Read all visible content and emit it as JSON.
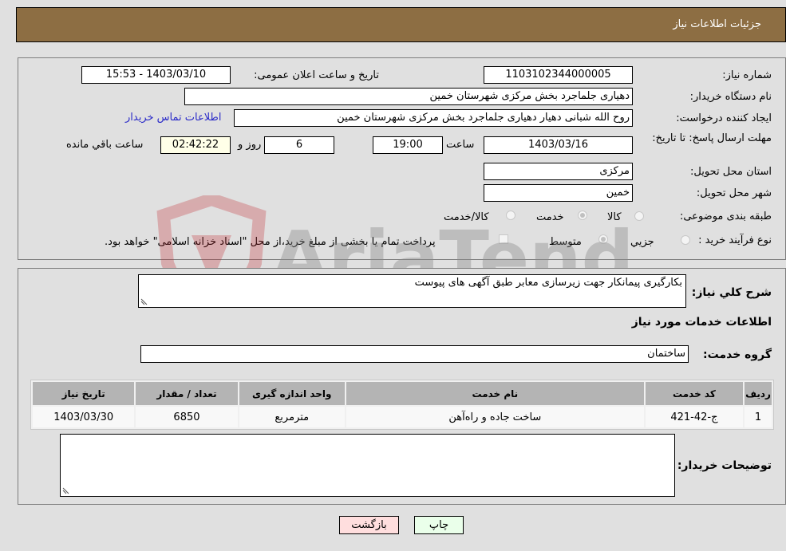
{
  "header": {
    "title": "جزئیات اطلاعات نیاز"
  },
  "form": {
    "need_number": {
      "label": "شماره نیاز:",
      "value": "1103102344000005"
    },
    "announce_datetime": {
      "label": "تاریخ و ساعت اعلان عمومی:",
      "value": "1403/03/10 - 15:53"
    },
    "buyer_org": {
      "label": "نام دستگاه خریدار:",
      "value": "دهیاری جلماجرد بخش مرکزی شهرستان خمین"
    },
    "requester": {
      "label": "ایجاد کننده درخواست:",
      "value": "روح الله شبانی دهیار  دهیاری جلماجرد بخش مرکزی شهرستان خمین"
    },
    "contact_link": "اطلاعات تماس خریدار",
    "deadline": {
      "label": "مهلت ارسال پاسخ: تا تاریخ:",
      "date": "1403/03/16",
      "time_label": "ساعت",
      "time": "19:00",
      "days": "6",
      "days_label": "روز و",
      "remaining": "02:42:22",
      "remaining_label": "ساعت باقي مانده"
    },
    "province": {
      "label": "استان محل تحویل:",
      "value": "مرکزی"
    },
    "city": {
      "label": "شهر محل تحویل:",
      "value": "خمین"
    },
    "category": {
      "label": "طبقه بندی موضوعی:",
      "options": [
        "کالا",
        "خدمت",
        "کالا/خدمت"
      ],
      "selected": "خدمت"
    },
    "purchase_type": {
      "label": "نوع فرآیند خرید :",
      "options": [
        "جزيي",
        "متوسط"
      ],
      "selected": "متوسط",
      "treasury_note": "پرداخت تمام یا بخشی از مبلغ خرید،از محل \"اسناد خزانه اسلامی\" خواهد بود."
    }
  },
  "details": {
    "description_label": "شرح كلي نياز:",
    "description": "بکارگیری پیمانکار جهت زیرسازی معابر طبق آگهی های پیوست",
    "services_heading": "اطلاعات خدمات مورد نیاز",
    "service_group_label": "گروه خدمت:",
    "service_group": "ساختمان",
    "table": {
      "headers": [
        "ردیف",
        "کد خدمت",
        "نام خدمت",
        "واحد اندازه گیری",
        "تعداد / مقدار",
        "تاریخ نیاز"
      ],
      "rows": [
        [
          "1",
          "ج-42-421",
          "ساخت جاده و راه‌آهن",
          "مترمربع",
          "6850",
          "1403/03/30"
        ]
      ]
    },
    "buyer_notes_label": "توضیحات خریدار:",
    "buyer_notes": ""
  },
  "buttons": {
    "print": "چاپ",
    "back": "بازگشت"
  },
  "watermark": {
    "text": "AriaTender.neT"
  },
  "colors": {
    "header": "#8d6e43",
    "print_bg": "#eaffea",
    "back_bg": "#ffdede",
    "link": "#2a2ac8"
  }
}
